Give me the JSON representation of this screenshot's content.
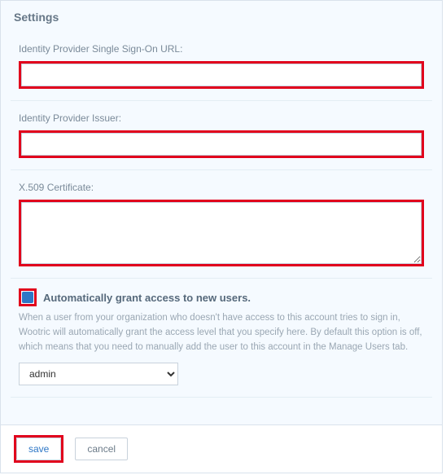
{
  "panel": {
    "title": "Settings"
  },
  "fields": {
    "sso_url": {
      "label": "Identity Provider Single Sign-On URL:",
      "value": ""
    },
    "issuer": {
      "label": "Identity Provider Issuer:",
      "value": ""
    },
    "cert": {
      "label": "X.509 Certificate:",
      "value": ""
    }
  },
  "auto_grant": {
    "checked": true,
    "label": "Automatically grant access to new users.",
    "help": "When a user from your organization who doesn't have access to this account tries to sign in, Wootric will automatically grant the access level that you specify here. By default this option is off, which means that you need to manually add the user to this account in the Manage Users tab.",
    "selected": "admin"
  },
  "footer": {
    "save_label": "save",
    "cancel_label": "cancel"
  }
}
